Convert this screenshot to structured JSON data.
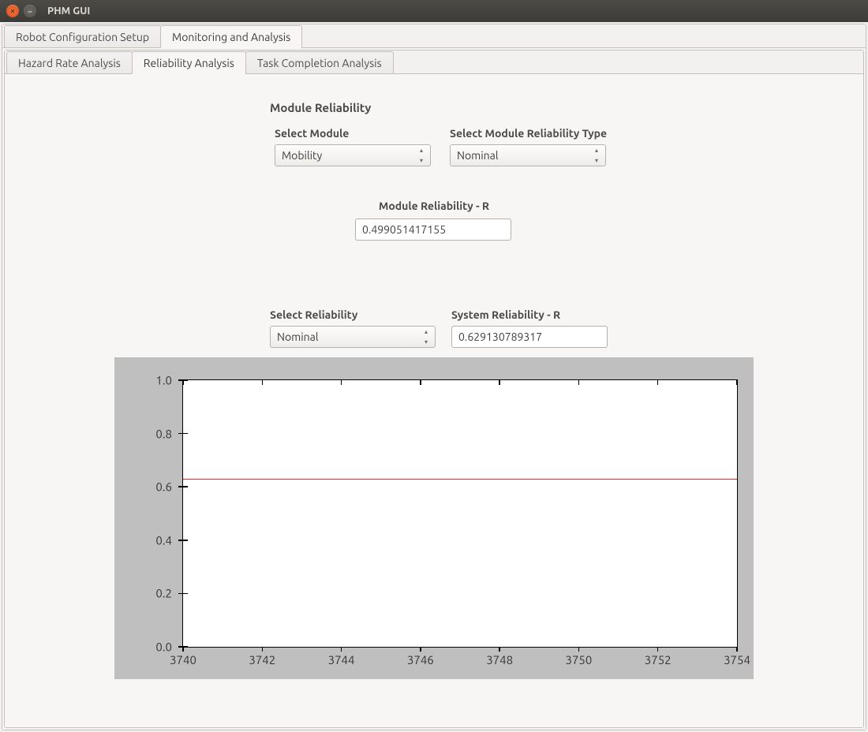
{
  "window": {
    "title": "PHM GUI"
  },
  "outer_tabs": [
    {
      "label": "Robot Configuration Setup",
      "active": false
    },
    {
      "label": "Monitoring and Analysis",
      "active": true
    }
  ],
  "inner_tabs": [
    {
      "label": "Hazard Rate Analysis",
      "active": false
    },
    {
      "label": "Reliability Analysis",
      "active": true
    },
    {
      "label": "Task Completion Analysis",
      "active": false
    }
  ],
  "module": {
    "section_title": "Module Reliability",
    "select_module_label": "Select Module",
    "select_module_value": "Mobility",
    "select_type_label": "Select Module Reliability Type",
    "select_type_value": "Nominal",
    "r_label": "Module Reliability - R",
    "r_value": "0.499051417155"
  },
  "system": {
    "select_reliability_label": "Select Reliability",
    "select_reliability_value": "Nominal",
    "r_label": "System Reliability - R",
    "r_value": "0.629130789317"
  },
  "chart_data": {
    "type": "line",
    "x": [
      3740,
      3742,
      3744,
      3746,
      3748,
      3750,
      3752,
      3754
    ],
    "series": [
      {
        "name": "System Reliability",
        "color": "#e62b2b",
        "values": [
          0.629,
          0.629,
          0.629,
          0.629,
          0.629,
          0.629,
          0.629,
          0.629
        ]
      }
    ],
    "x_ticks": [
      3740,
      3742,
      3744,
      3746,
      3748,
      3750,
      3752,
      3754
    ],
    "y_ticks": [
      0.0,
      0.2,
      0.4,
      0.6,
      0.8,
      1.0
    ],
    "xlim": [
      3740,
      3754
    ],
    "ylim": [
      0.0,
      1.0
    ],
    "title": "",
    "xlabel": "",
    "ylabel": ""
  }
}
